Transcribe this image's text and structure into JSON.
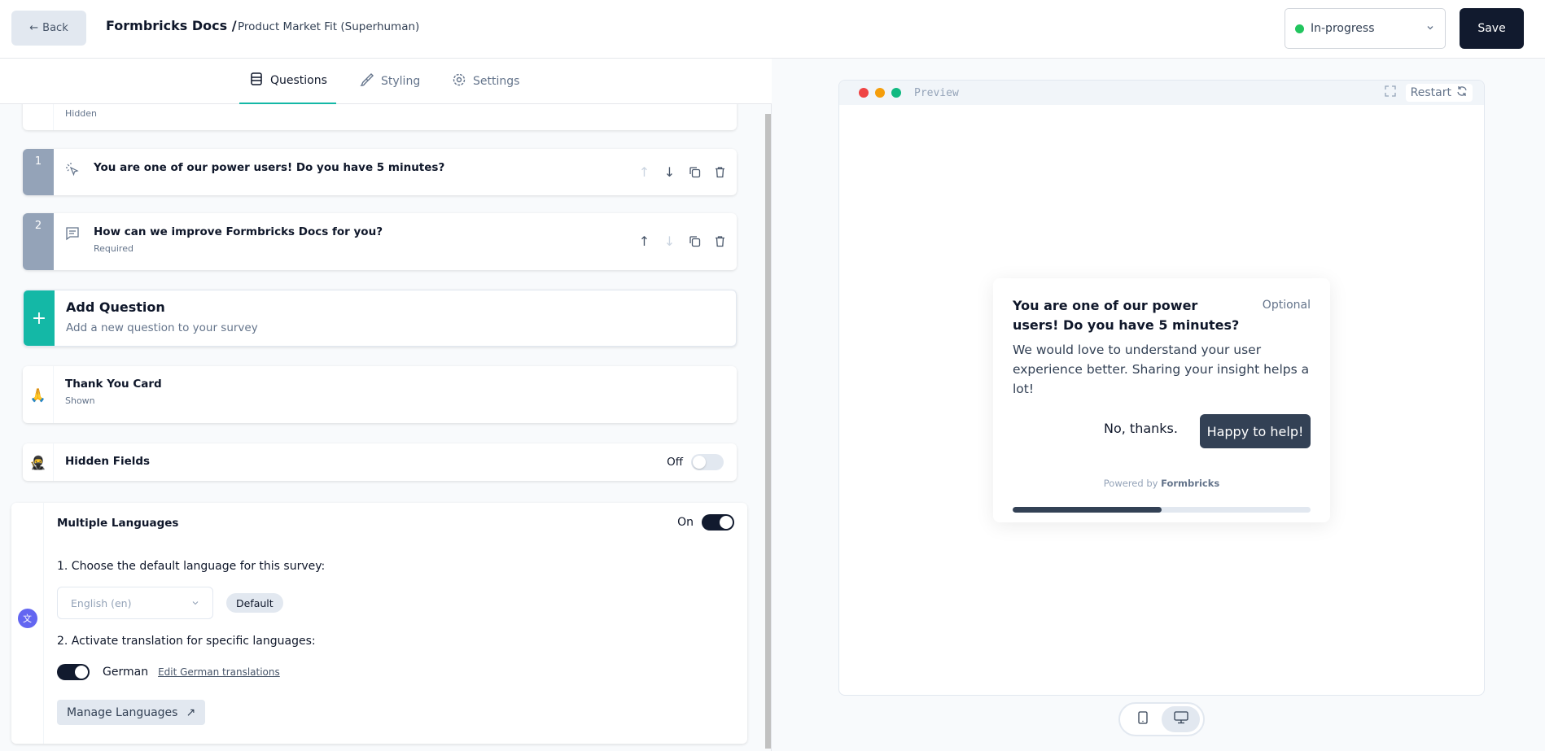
{
  "header": {
    "back_label": "Back",
    "brand": "Formbricks Docs /",
    "survey_name": "Product Market Fit (Superhuman)",
    "status": {
      "label": "In-progress",
      "color": "#22c55e"
    },
    "save_label": "Save"
  },
  "tabs": [
    {
      "label": "Questions",
      "icon": "questions-icon",
      "active": true
    },
    {
      "label": "Styling",
      "icon": "paintbrush-icon",
      "active": false
    },
    {
      "label": "Settings",
      "icon": "gear-icon",
      "active": false
    }
  ],
  "welcome_card": {
    "status": "Hidden"
  },
  "questions": [
    {
      "number": "1",
      "icon": "cta-cursor-icon",
      "title": "You are one of our power users! Do you have 5 minutes?",
      "subtitle": ""
    },
    {
      "number": "2",
      "icon": "open-text-icon",
      "title": "How can we improve Formbricks Docs for you?",
      "subtitle": "Required"
    }
  ],
  "add_question": {
    "title": "Add Question",
    "subtitle": "Add a new question to your survey"
  },
  "thank_you_card": {
    "title": "Thank You Card",
    "status": "Shown",
    "emoji": "🙏"
  },
  "hidden_fields": {
    "title": "Hidden Fields",
    "toggle_label": "Off",
    "emoji": "🥷"
  },
  "languages": {
    "title": "Multiple Languages",
    "toggle_label": "On",
    "step1": "1. Choose the default language for this survey:",
    "default_language": "English (en)",
    "default_badge": "Default",
    "step2": "2. Activate translation for specific languages:",
    "language": "German",
    "edit_link": "Edit German translations",
    "manage_label": "Manage Languages"
  },
  "preview": {
    "label": "Preview",
    "restart_label": "Restart",
    "dot_colors": [
      "#ef4444",
      "#f59e0b",
      "#10b981"
    ],
    "card": {
      "title": "You are one of our power users! Do you have 5 minutes?",
      "optional": "Optional",
      "description": "We would love to understand your user experience better. Sharing your insight helps a lot!",
      "dismiss_label": "No, thanks.",
      "accept_label": "Happy to help!",
      "powered_prefix": "Powered by",
      "powered_brand": "Formbricks",
      "progress_fraction": 0.5
    }
  }
}
